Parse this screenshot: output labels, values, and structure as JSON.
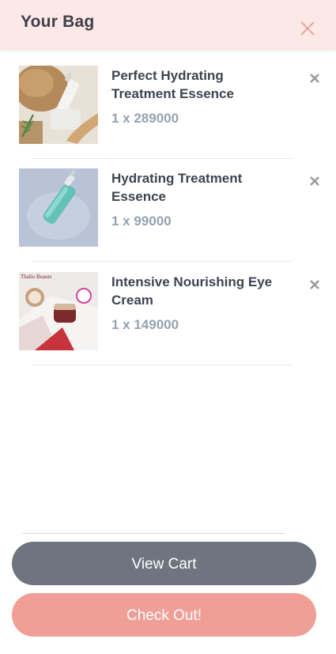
{
  "header": {
    "title": "Your Bag",
    "close_icon": "close-icon"
  },
  "items": [
    {
      "name": "Perfect Hydrating Treatment Essence",
      "price": "1 x 289000"
    },
    {
      "name": "Hydrating Treatment Essence",
      "price": "1 x 99000"
    },
    {
      "name": "Intensive Nourishing Eye Cream",
      "price": "1 x 149000"
    }
  ],
  "thumb3_brand": "Thalio Beaute",
  "remove_icon": "remove-icon",
  "actions": {
    "view_cart": "View Cart",
    "checkout": "Check Out!"
  },
  "colors": {
    "header_bg": "#fbe8e7",
    "view_cart_bg": "#6f7580",
    "checkout_bg": "#f09f97",
    "price_color": "#94a3b1"
  }
}
